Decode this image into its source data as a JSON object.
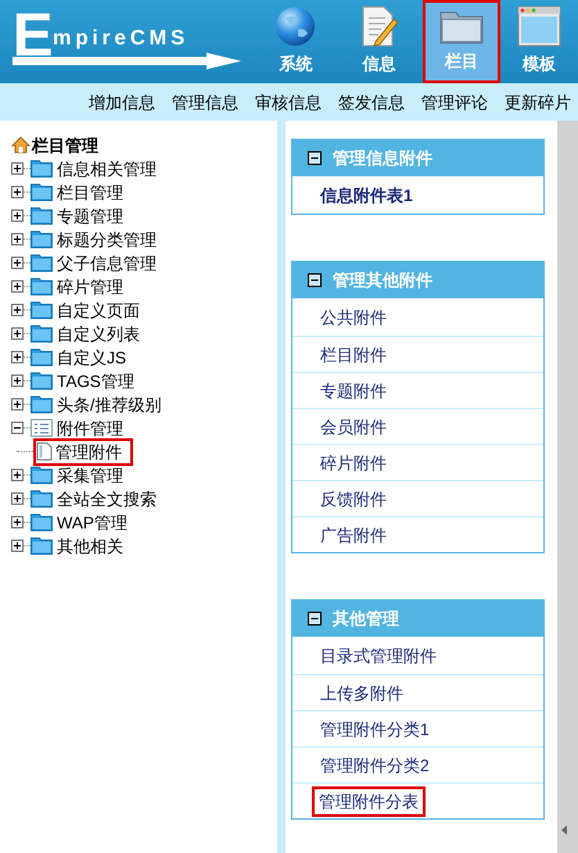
{
  "header": {
    "logo": {
      "initial": "E",
      "rest": "mpireCMS"
    },
    "nav_icons": [
      {
        "kind": "globe",
        "label": "系统",
        "selected": false
      },
      {
        "kind": "notepad",
        "label": "信息",
        "selected": false
      },
      {
        "kind": "folder",
        "label": "栏目",
        "selected": true
      },
      {
        "kind": "window",
        "label": "模板",
        "selected": false
      }
    ]
  },
  "menu_bar": [
    "增加信息",
    "管理信息",
    "审核信息",
    "签发信息",
    "管理评论",
    "更新碎片"
  ],
  "tree": {
    "root": "栏目管理",
    "items": [
      {
        "label": "信息相关管理",
        "expanded": false
      },
      {
        "label": "栏目管理",
        "expanded": false
      },
      {
        "label": "专题管理",
        "expanded": false
      },
      {
        "label": "标题分类管理",
        "expanded": false
      },
      {
        "label": "父子信息管理",
        "expanded": false
      },
      {
        "label": "碎片管理",
        "expanded": false
      },
      {
        "label": "自定义页面",
        "expanded": false
      },
      {
        "label": "自定义列表",
        "expanded": false
      },
      {
        "label": "自定义JS",
        "expanded": false
      },
      {
        "label": "TAGS管理",
        "expanded": false
      },
      {
        "label": "头条/推荐级别",
        "expanded": false
      },
      {
        "label": "附件管理",
        "expanded": true,
        "children": [
          {
            "label": "管理附件",
            "highlighted": true
          }
        ]
      },
      {
        "label": "采集管理",
        "expanded": false
      },
      {
        "label": "全站全文搜索",
        "expanded": false
      },
      {
        "label": "WAP管理",
        "expanded": false
      },
      {
        "label": "其他相关",
        "expanded": false
      }
    ]
  },
  "panels": [
    {
      "title": "管理信息附件",
      "items": [
        {
          "label": "信息附件表1",
          "bold": true,
          "highlighted": false
        }
      ]
    },
    {
      "title": "管理其他附件",
      "items": [
        {
          "label": "公共附件",
          "bold": false,
          "highlighted": false
        },
        {
          "label": "栏目附件",
          "bold": false,
          "highlighted": false
        },
        {
          "label": "专题附件",
          "bold": false,
          "highlighted": false
        },
        {
          "label": "会员附件",
          "bold": false,
          "highlighted": false
        },
        {
          "label": "碎片附件",
          "bold": false,
          "highlighted": false
        },
        {
          "label": "反馈附件",
          "bold": false,
          "highlighted": false
        },
        {
          "label": "广告附件",
          "bold": false,
          "highlighted": false
        }
      ]
    },
    {
      "title": "其他管理",
      "items": [
        {
          "label": "目录式管理附件",
          "bold": false,
          "highlighted": false
        },
        {
          "label": "上传多附件",
          "bold": false,
          "highlighted": false
        },
        {
          "label": "管理附件分类1",
          "bold": false,
          "highlighted": false
        },
        {
          "label": "管理附件分类2",
          "bold": false,
          "highlighted": false
        },
        {
          "label": "管理附件分表",
          "bold": false,
          "highlighted": true
        }
      ]
    }
  ]
}
